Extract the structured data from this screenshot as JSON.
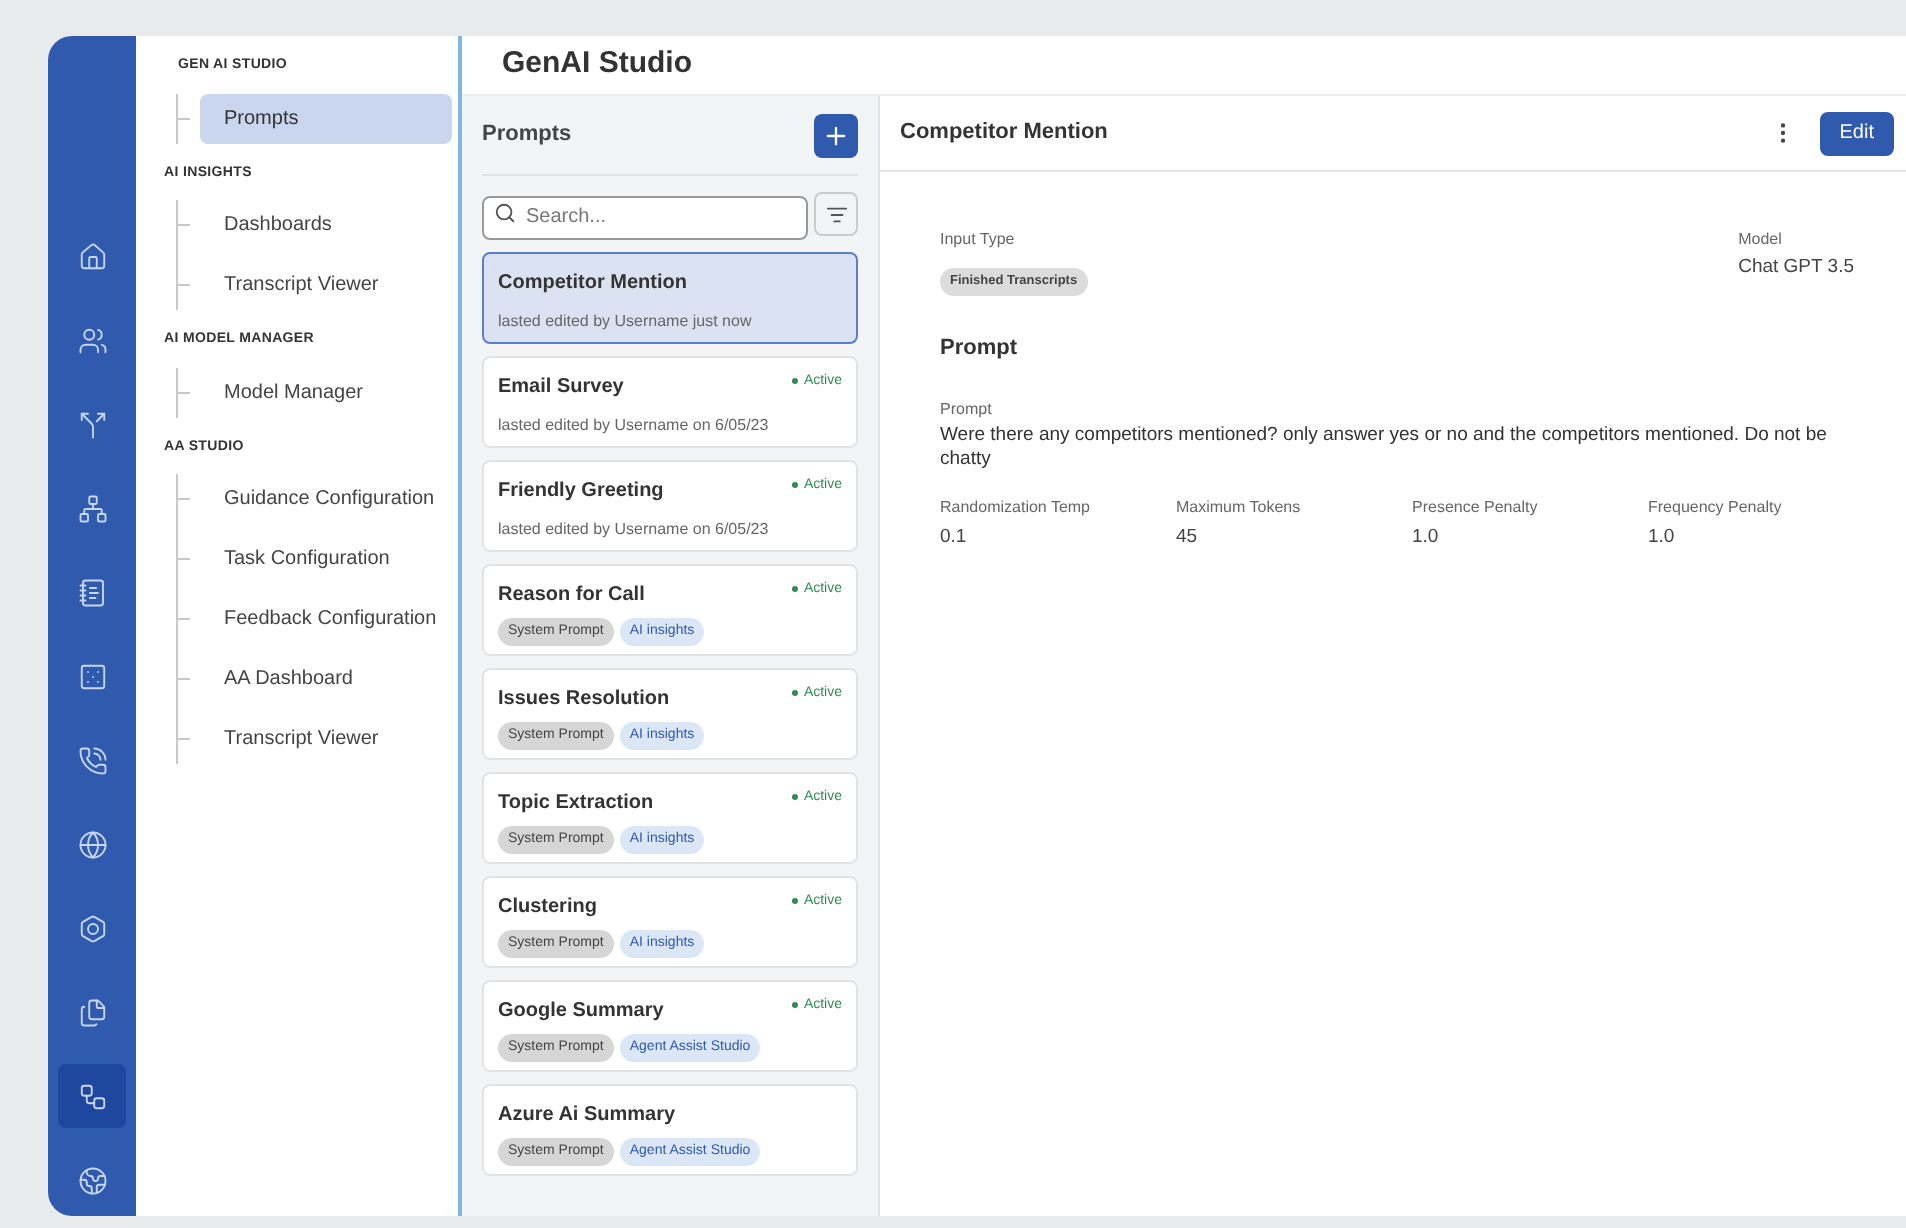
{
  "rail": [
    {
      "selected": false
    },
    {
      "selected": false
    },
    {
      "selected": false
    },
    {
      "selected": false
    },
    {
      "selected": false
    },
    {
      "selected": false
    },
    {
      "selected": false
    },
    {
      "selected": false
    },
    {
      "selected": false
    },
    {
      "selected": false
    },
    {
      "selected": true
    },
    {
      "selected": false
    }
  ],
  "nav": [
    {
      "heading": "GEN AI STUDIO",
      "items": [
        {
          "label": "Prompts",
          "selected": true
        }
      ]
    },
    {
      "heading": "AI INSIGHTS",
      "items": [
        {
          "label": "Dashboards",
          "selected": false
        },
        {
          "label": "Transcript Viewer",
          "selected": false
        }
      ]
    },
    {
      "heading": "AI MODEL MANAGER",
      "items": [
        {
          "label": "Model Manager",
          "selected": false
        }
      ]
    },
    {
      "heading": "AA STUDIO",
      "items": [
        {
          "label": "Guidance Configuration",
          "selected": false
        },
        {
          "label": "Task Configuration",
          "selected": false
        },
        {
          "label": "Feedback Configuration",
          "selected": false
        },
        {
          "label": "AA Dashboard",
          "selected": false
        },
        {
          "label": "Transcript Viewer",
          "selected": false
        }
      ]
    }
  ],
  "app_title": "GenAI Studio",
  "list": {
    "title": "Prompts",
    "search": {
      "placeholder": "Search..."
    },
    "items": [
      {
        "title": "Competitor Mention",
        "subtitle": "lasted edited by Username just now",
        "selected": true
      },
      {
        "title": "Email Survey",
        "subtitle": "lasted edited by Username on 6/05/23",
        "status": "Active",
        "selected": false
      },
      {
        "title": "Friendly Greeting",
        "subtitle": "lasted edited by Username on 6/05/23",
        "status": "Active",
        "selected": false
      },
      {
        "title": "Reason for Call",
        "tags": [
          {
            "label": "System Prompt",
            "kind": "system"
          },
          {
            "label": "AI insights",
            "kind": "module"
          }
        ],
        "status": "Active",
        "selected": false
      },
      {
        "title": "Issues Resolution",
        "tags": [
          {
            "label": "System Prompt",
            "kind": "system"
          },
          {
            "label": "AI insights",
            "kind": "module"
          }
        ],
        "status": "Active",
        "selected": false
      },
      {
        "title": "Topic Extraction",
        "tags": [
          {
            "label": "System Prompt",
            "kind": "system"
          },
          {
            "label": "AI insights",
            "kind": "module"
          }
        ],
        "status": "Active",
        "selected": false
      },
      {
        "title": "Clustering",
        "tags": [
          {
            "label": "System Prompt",
            "kind": "system"
          },
          {
            "label": "AI insights",
            "kind": "module"
          }
        ],
        "status": "Active",
        "selected": false
      },
      {
        "title": "Google Summary",
        "tags": [
          {
            "label": "System Prompt",
            "kind": "system"
          },
          {
            "label": "Agent Assist Studio",
            "kind": "module"
          }
        ],
        "status": "Active",
        "selected": false
      },
      {
        "title": "Azure Ai Summary",
        "tags": [
          {
            "label": "System Prompt",
            "kind": "system"
          },
          {
            "label": "Agent Assist Studio",
            "kind": "module"
          }
        ],
        "selected": false
      }
    ]
  },
  "detail": {
    "title": "Competitor Mention",
    "edit_button": "Edit",
    "input_type": {
      "label": "Input Type",
      "value": "Finished Transcripts"
    },
    "model": {
      "label": "Model",
      "value": "Chat GPT 3.5"
    },
    "section_title": "Prompt",
    "prompt": {
      "label": "Prompt",
      "value": "Were there any competitors mentioned? only answer yes or no and the competitors mentioned. Do not be chatty"
    },
    "params": [
      {
        "label": "Randomization Temp",
        "value": "0.1"
      },
      {
        "label": "Maximum Tokens",
        "value": "45"
      },
      {
        "label": "Presence Penalty",
        "value": "1.0"
      },
      {
        "label": "Frequency Penalty",
        "value": "1.0"
      }
    ]
  }
}
